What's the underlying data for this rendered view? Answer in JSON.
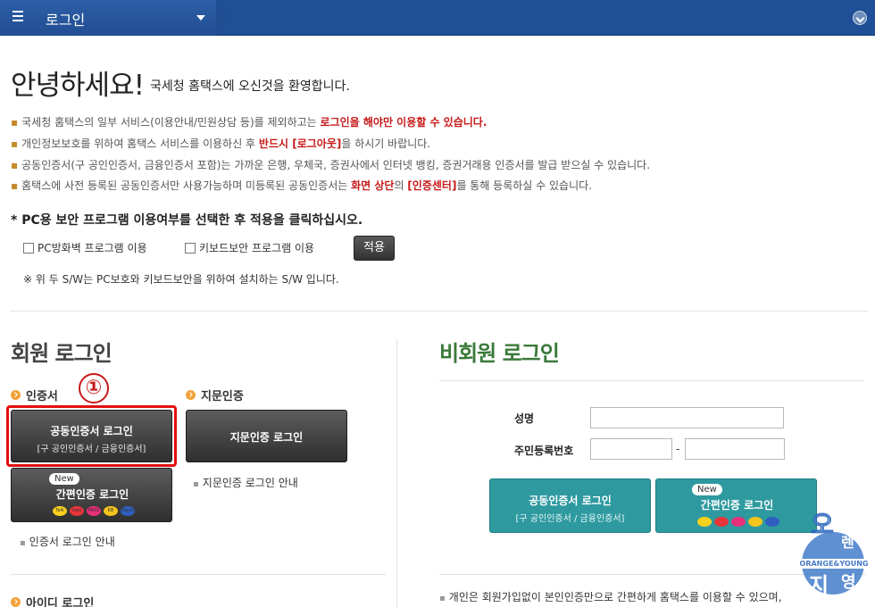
{
  "header": {
    "tab_title": "로그인"
  },
  "greeting": {
    "title": "안녕하세요!",
    "subtitle": "국세청 홈택스에 오신것을 환영합니다."
  },
  "notices": [
    {
      "pre": "국세청 홈택스의 일부 서비스(이용안내/민원상담 등)를 제외하고는 ",
      "hl": "로그인을 해야만 이용할 수 있습니다.",
      "post": ""
    },
    {
      "pre": "개인정보보호를 위하여 홈택스 서비스를 이용하신 후 ",
      "hl": "반드시 [로그아웃]",
      "post": "을 하시기 바랍니다."
    },
    {
      "pre": "공동인증서(구 공인인증서, 금융인증서 포함)는 가까운 은행, 우체국, 증권사에서 인터넷 뱅킹, 증권거래용 인증서를 발급 받으실 수 있습니다.",
      "hl": "",
      "post": ""
    },
    {
      "pre": "홈택스에 사전 등록된 공동인증서만 사용가능하며 미등록된 공동인증서는 ",
      "hl": "화면 상단",
      "post": "의 ",
      "hl2": "[인증센터]",
      "post2": "를 통해 등록하실 수 있습니다."
    }
  ],
  "pc_security": {
    "title": "* PC용 보안 프로그램 이용여부를 선택한 후 적용을 클릭하십시오.",
    "firewall_label": "PC방화벽 프로그램 이용",
    "firewall_checked": false,
    "keyboard_label": "키보드보안 프로그램 이용",
    "keyboard_checked": false,
    "apply_label": "적용",
    "note": "※ 위 두 S/W는 PC보호와 키보드보안을 위하여 설치하는 S/W 입니다."
  },
  "member": {
    "title": "회원 로그인",
    "cert_label": "인증서",
    "step_marker": "①",
    "cert_btn_main": "공동인증서 로그인",
    "cert_btn_sub": "[구 공인인증서 / 금융인증서]",
    "simple_new": "New",
    "simple_btn_main": "간편인증 로그인",
    "cert_guide": "인증서 로그인 안내",
    "finger_label": "지문인증",
    "finger_btn": "지문인증 로그인",
    "finger_guide": "지문인증 로그인 안내",
    "id_label": "아이디 로그인"
  },
  "guest": {
    "title": "비회원 로그인",
    "name_label": "성명",
    "name_value": "",
    "rrn_label": "주민등록번호",
    "rrn_front": "",
    "rrn_back": "",
    "dash": "-",
    "cert_btn_main": "공동인증서 로그인",
    "cert_btn_sub": "[구 공인인증서 / 금융인증서]",
    "simple_new": "New",
    "simple_btn_main": "간편인증 로그인",
    "bottom_note": "개인은 회원가입없이 본인인증만으로 간편하게 홈택스를 이용할 수 있으며,"
  },
  "simple_logos": [
    "Talk",
    "toss",
    "PASS",
    "KB",
    "Payco"
  ],
  "watermark": {
    "chars": [
      "오",
      "렌",
      "지",
      "영"
    ],
    "band": "ORANGE&YOUNG"
  },
  "colors": {
    "header_blue": "#1f4f96",
    "highlight_red": "#c71a1a",
    "teal": "#2e9aa0",
    "guest_green": "#3a7a3a"
  }
}
